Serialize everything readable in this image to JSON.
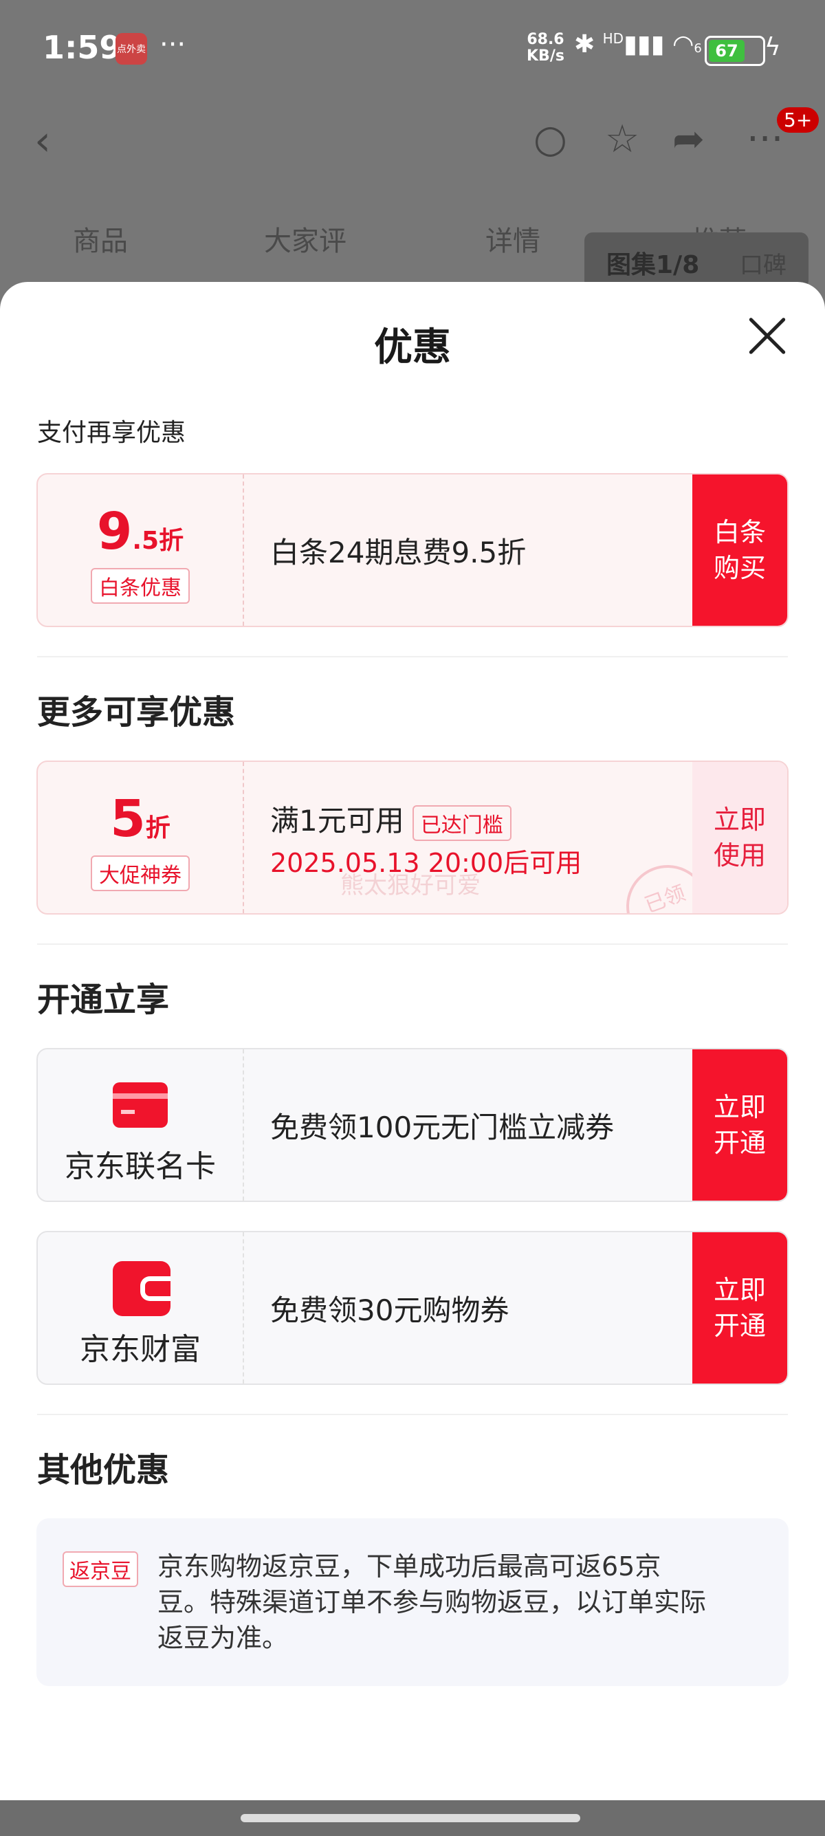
{
  "status_bar": {
    "time": "1:59",
    "app_icon_label": "点外卖",
    "more": "···",
    "net_speed_value": "68.6",
    "net_speed_unit": "KB/s",
    "signal_label": "HD",
    "wifi_label": "6",
    "battery": "67"
  },
  "nav": {
    "back_icon": "chevron-left-icon",
    "search_icon": "search-icon",
    "favorite_icon": "star-icon",
    "share_icon": "share-icon",
    "more_icon": "more-icon",
    "badge": "5+"
  },
  "product_tabs": [
    "商品",
    "大家评",
    "详情",
    "推荐"
  ],
  "gallery": {
    "label": "图集1/8",
    "reviews": "口碑"
  },
  "sheet": {
    "title": "优惠",
    "section1": {
      "title": "支付再享优惠",
      "card": {
        "value_main": "9",
        "value_decimal": ".5",
        "value_unit": "折",
        "tag": "白条优惠",
        "desc": "白条24期息费9.5折",
        "button": "白条\n购买"
      }
    },
    "section2": {
      "title": "更多可享优惠",
      "card": {
        "value_main": "5",
        "value_unit": "折",
        "tag": "大促神券",
        "condition": "满1元可用",
        "reached": "已达门槛",
        "time": "2025.05.13 20:00后可用",
        "watermark": "熊太狠好可爱",
        "stamp": "已领",
        "button": "立即\n使用"
      }
    },
    "section3": {
      "title": "开通立享",
      "cards": [
        {
          "icon": "credit-card-icon",
          "name": "京东联名卡",
          "desc": "免费领100元无门槛立减券",
          "button": "立即\n开通"
        },
        {
          "icon": "wallet-icon",
          "name": "京东财富",
          "desc": "免费领30元购物券",
          "button": "立即\n开通"
        }
      ]
    },
    "section4": {
      "title": "其他优惠",
      "tag": "返京豆",
      "text": "京东购物返京豆，下单成功后最高可返65京豆。特殊渠道订单不参与购物返豆，以订单实际返豆为准。"
    }
  },
  "colors": {
    "accent": "#f5142c",
    "accent_text": "#e8122b",
    "pink_bg": "#fdf4f4",
    "gray_bg": "#f8f8fa",
    "overlay": "#777777"
  }
}
